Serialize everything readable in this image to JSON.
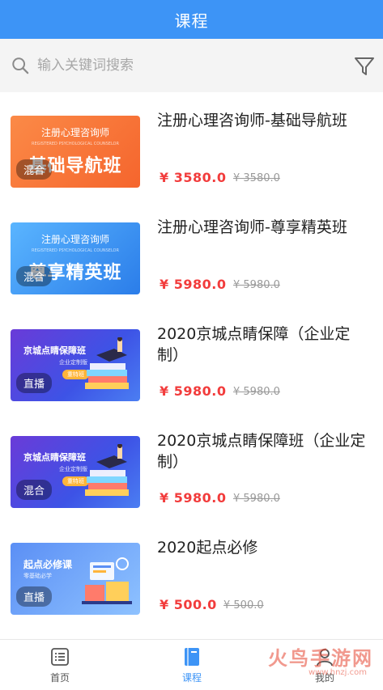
{
  "header": {
    "title": "课程"
  },
  "search": {
    "placeholder": "输入关键词搜索",
    "value": ""
  },
  "courses": [
    {
      "title": "注册心理咨询师-基础导航班",
      "price": "¥ 3580.0",
      "original_price": "¥ 3580.0",
      "badge": "混合",
      "thumb_subtitle": "注册心理咨询师",
      "thumb_tagline": "REGISTERED PSYCHOLOGICAL COUNSELOR",
      "thumb_title": "基础导航班"
    },
    {
      "title": "注册心理咨询师-尊享精英班",
      "price": "¥ 5980.0",
      "original_price": "¥ 5980.0",
      "badge": "混合",
      "thumb_subtitle": "注册心理咨询师",
      "thumb_tagline": "REGISTERED PSYCHOLOGICAL COUNSELOR",
      "thumb_title": "尊享精英班"
    },
    {
      "title": "2020京城点睛保障（企业定制）",
      "price": "¥ 5980.0",
      "original_price": "¥ 5980.0",
      "badge": "直播",
      "thumb_title": "京城点睛保障班",
      "thumb_subtitle": "企业定制版",
      "thumb_pill": "重特班"
    },
    {
      "title": "2020京城点睛保障班（企业定制）",
      "price": "¥ 5980.0",
      "original_price": "¥ 5980.0",
      "badge": "混合",
      "thumb_title": "京城点睛保障班",
      "thumb_subtitle": "企业定制版",
      "thumb_pill": "重特班"
    },
    {
      "title": "2020起点必修",
      "price": "¥ 500.0",
      "original_price": "¥ 500.0",
      "badge": "直播",
      "thumb_title": "起点必修课",
      "thumb_subtitle": "零基础必学"
    }
  ],
  "tabbar": [
    {
      "label": "首页",
      "icon": "list-icon",
      "active": false
    },
    {
      "label": "课程",
      "icon": "book-icon",
      "active": true
    },
    {
      "label": "我的",
      "icon": "user-icon",
      "active": false
    }
  ],
  "watermark": {
    "text": "火鸟手游网",
    "url": "www.hnzj.com"
  },
  "colors": {
    "primary": "#3d94f6",
    "price": "#f23c3c",
    "muted": "#999999"
  }
}
